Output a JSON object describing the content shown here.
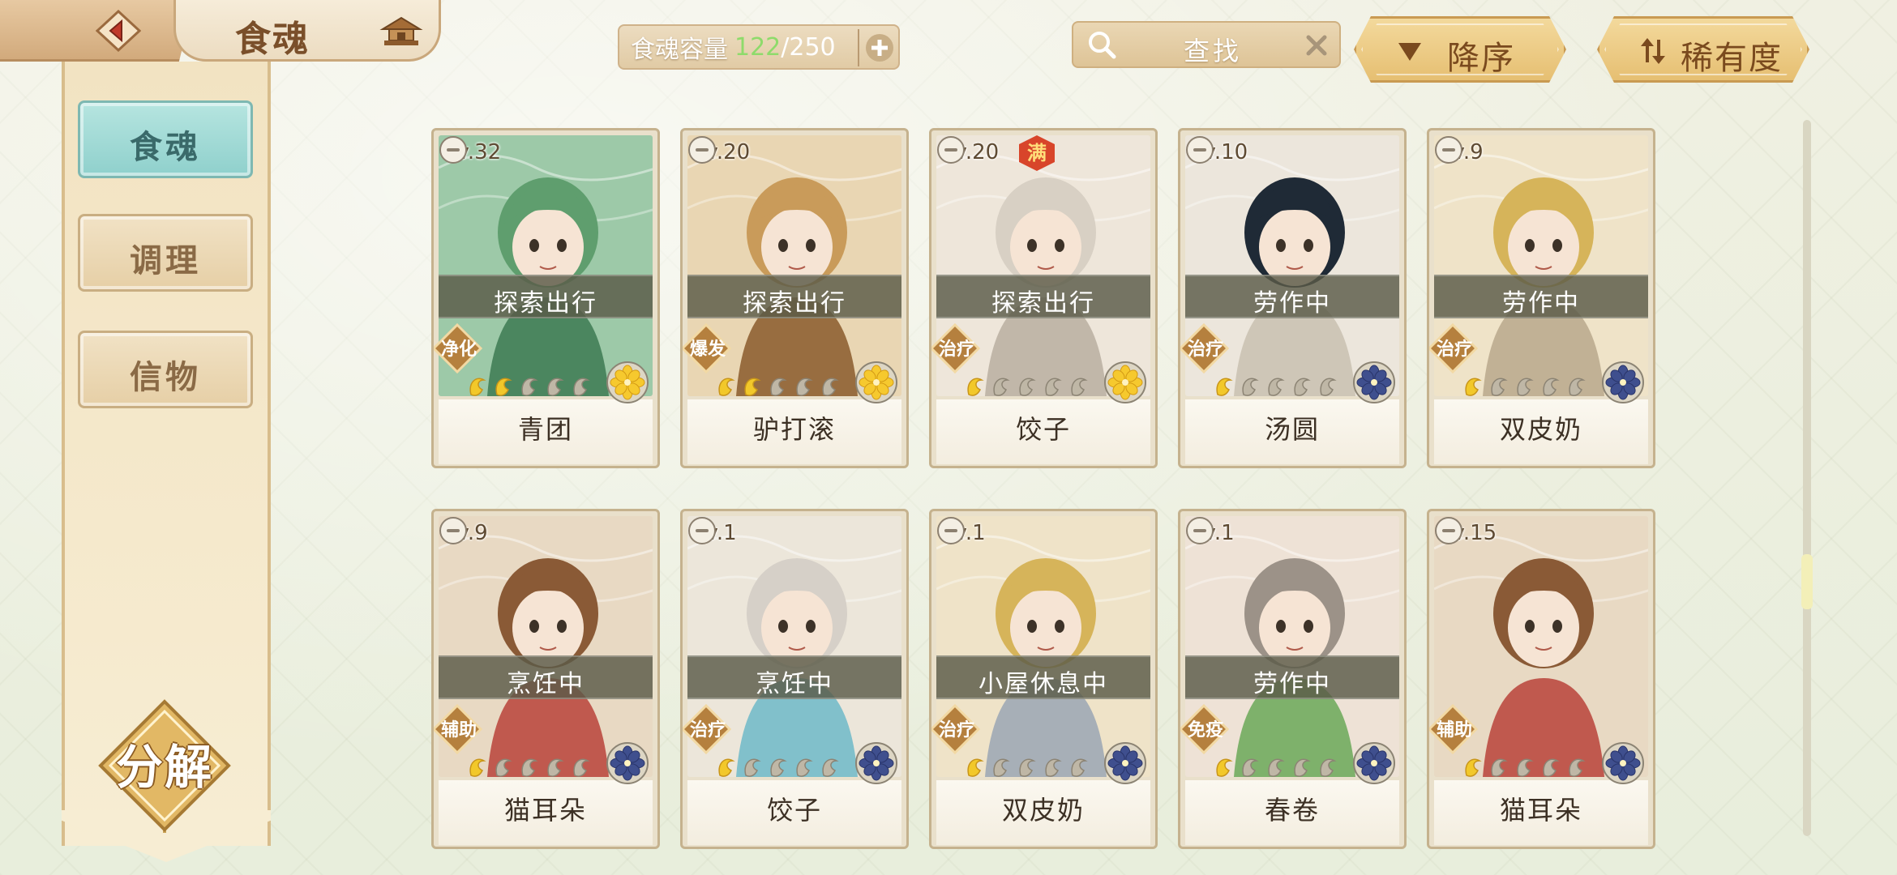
{
  "header": {
    "title": "食魂",
    "back_icon": "back-arrow-icon",
    "home_icon": "pavilion-icon"
  },
  "capacity": {
    "label": "食魂容量",
    "current": "122",
    "separator": "/",
    "max": "250"
  },
  "search": {
    "placeholder": "查找"
  },
  "sort": {
    "order_label": "降序",
    "by_label": "稀有度"
  },
  "sidebar": {
    "tabs": [
      {
        "label": "食魂",
        "active": true
      },
      {
        "label": "调理",
        "active": false
      },
      {
        "label": "信物",
        "active": false
      }
    ],
    "decompose_label": "分解"
  },
  "colors": {
    "accent_teal": "#8fd0cc",
    "gold": "#e6bf72",
    "capacity_green": "#8edb6b"
  },
  "cards": [
    {
      "level": "Lv.32",
      "status": "探索出行",
      "role": "净化",
      "name": "青团",
      "stars_filled": 2,
      "element": "yellow-flower-icon",
      "full": false
    },
    {
      "level": "Lv.20",
      "status": "探索出行",
      "role": "爆发",
      "name": "驴打滚",
      "stars_filled": 2,
      "element": "yellow-flower-icon",
      "full": false
    },
    {
      "level": "Lv.20",
      "status": "探索出行",
      "role": "治疗",
      "name": "饺子",
      "stars_filled": 1,
      "element": "yellow-flower-icon",
      "full": true,
      "full_label": "满"
    },
    {
      "level": "Lv.10",
      "status": "劳作中",
      "role": "治疗",
      "name": "汤圆",
      "stars_filled": 1,
      "element": "blue-flower-icon",
      "full": false
    },
    {
      "level": "Lv.9",
      "status": "劳作中",
      "role": "治疗",
      "name": "双皮奶",
      "stars_filled": 1,
      "element": "blue-flower-icon",
      "full": false
    },
    {
      "level": "Lv.9",
      "status": "烹饪中",
      "role": "辅助",
      "name": "猫耳朵",
      "stars_filled": 1,
      "element": "blue-flower-icon",
      "full": false
    },
    {
      "level": "Lv.1",
      "status": "烹饪中",
      "role": "治疗",
      "name": "饺子",
      "stars_filled": 1,
      "element": "blue-flower-icon",
      "full": false
    },
    {
      "level": "Lv.1",
      "status": "小屋休息中",
      "role": "治疗",
      "name": "双皮奶",
      "stars_filled": 1,
      "element": "blue-flower-icon",
      "full": false
    },
    {
      "level": "Lv.1",
      "status": "劳作中",
      "role": "免疫",
      "name": "春卷",
      "stars_filled": 1,
      "element": "blue-flower-icon",
      "full": false
    },
    {
      "level": "Lv.15",
      "status": "",
      "role": "辅助",
      "name": "猫耳朵",
      "stars_filled": 1,
      "element": "blue-flower-icon",
      "full": false
    }
  ]
}
